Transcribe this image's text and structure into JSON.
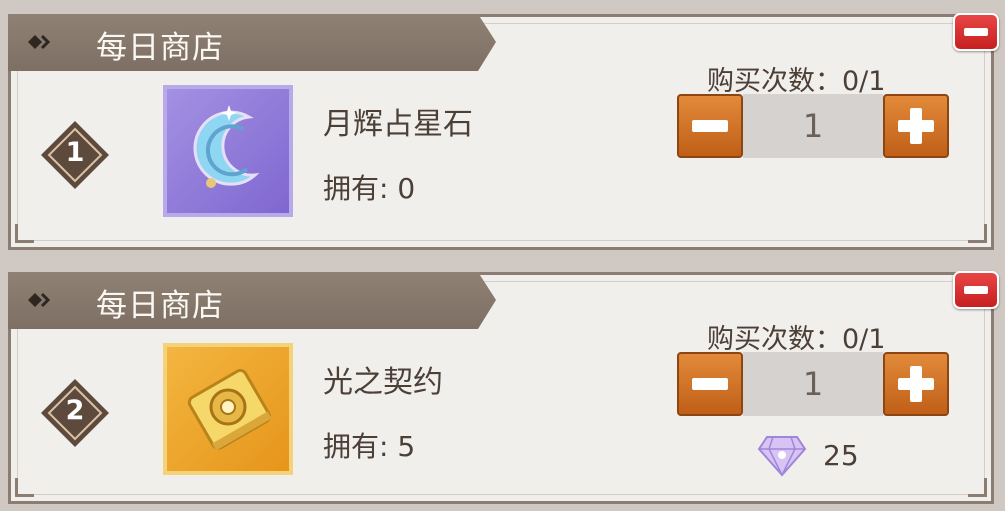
{
  "cards": [
    {
      "banner_title": "每日商店",
      "index": "1",
      "item_name": "月辉占星石",
      "owned": "拥有: 0",
      "icon": "moon-stone-icon",
      "limit": "购买次数：0/1",
      "quantity": "1"
    },
    {
      "banner_title": "每日商店",
      "index": "2",
      "item_name": "光之契约",
      "owned": "拥有: 5",
      "icon": "golden-contract-icon",
      "limit": "购买次数：0/1",
      "quantity": "1",
      "price": "25",
      "currency_icon": "diamond-icon"
    }
  ],
  "colors": {
    "banner": "#857669",
    "card_bg": "#f1efec",
    "stepper_orange": "#d2742a",
    "close_red": "#d83232",
    "text": "#4b3f36"
  }
}
